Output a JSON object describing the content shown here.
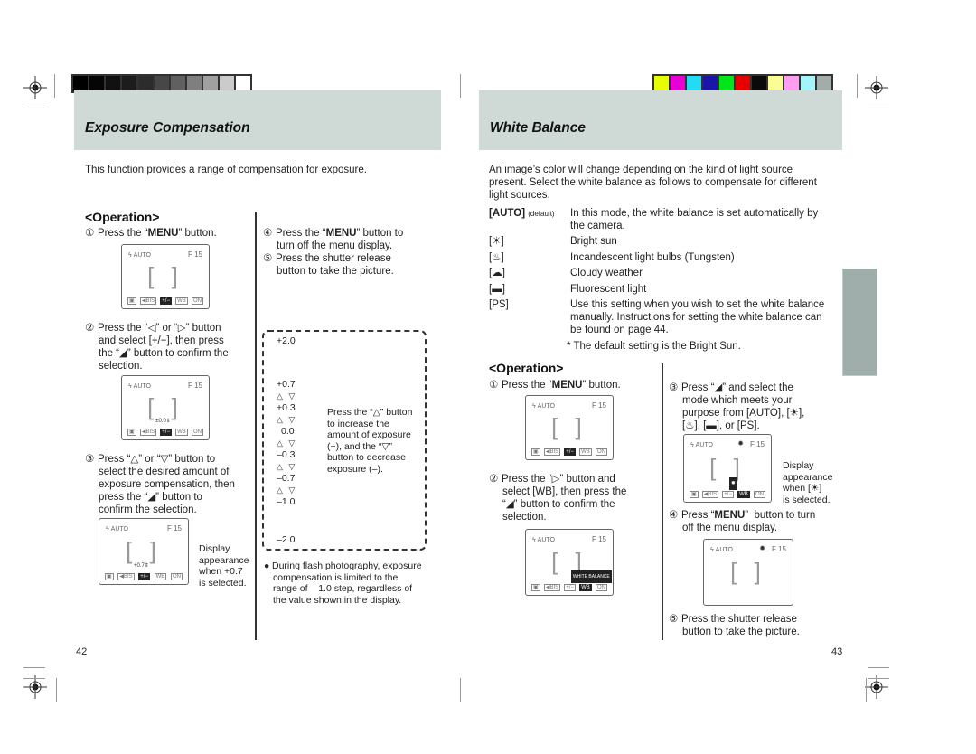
{
  "calibration": {
    "grayscale": [
      "#000000",
      "#050505",
      "#111111",
      "#1c1c1c",
      "#2c2c2c",
      "#474747",
      "#606060",
      "#7f7f7f",
      "#a0a0a0",
      "#cbcbcb",
      "#ffffff"
    ],
    "colors": [
      "#e6ff00",
      "#e600d6",
      "#22dcf5",
      "#1a16a8",
      "#00e61a",
      "#e80000",
      "#0a0a0a",
      "#fcfc94",
      "#ff9eee",
      "#a3f5fa",
      "#a2acab"
    ]
  },
  "left_page": {
    "title": "Exposure Compensation",
    "intro": "This function provides a range of compensation for exposure.",
    "operation_heading": "<Operation>",
    "steps": [
      {
        "num": "①",
        "text_pre": "Press the “",
        "bold": "MENU",
        "text_post": "” button."
      },
      {
        "num": "②",
        "lines": [
          "Press the “◁” or “▷” button",
          "and select [+/−], then press",
          "the “◢” button to confirm the",
          "selection."
        ]
      },
      {
        "num": "③",
        "lines": [
          "Press “△” or “▽” button to",
          "select the desired amount of",
          "exposure compensation, then",
          "press the “◢” button to",
          "confirm the selection."
        ]
      },
      {
        "num": "④",
        "text_pre": "Press the “",
        "bold": "MENU",
        "text_post": "” button to",
        "line2": "turn off the menu display."
      },
      {
        "num": "⑤",
        "lines": [
          "Press the shutter release",
          "button to take the picture."
        ]
      }
    ],
    "display_caption": [
      "Display",
      "appearance",
      "when +0.7",
      "is selected."
    ],
    "lcd": {
      "flash": "ϟ AUTO",
      "fnum": "F  15",
      "icons": [
        "▣",
        "◀BIS",
        "+/−",
        "WB",
        "ON"
      ],
      "value_step2": "±0.0⇕",
      "value_step3": "+0.7⇕"
    },
    "scale": {
      "values": [
        "+2.0",
        "+0.7",
        "+0.3",
        "0.0",
        "–0.3",
        "–0.7",
        "–1.0",
        "–2.0"
      ],
      "arrows": "△ ▽",
      "note": [
        "Press the “△” button",
        "to increase the",
        "amount of exposure",
        "(+), and the “▽”",
        "button to decrease",
        "exposure (–)."
      ]
    },
    "flash_note": [
      "During flash photography, exposure",
      "compensation is limited to the",
      "range of    1.0 step, regardless of",
      "the value shown in the display."
    ],
    "page_number": "42"
  },
  "right_page": {
    "title": "White Balance",
    "intro": [
      "An image’s color will change depending on the kind of light source",
      "present. Select the white balance as follows to compensate for different",
      "light sources."
    ],
    "modes": [
      {
        "key": "[AUTO]",
        "key_note": "(default)",
        "icon": "auto",
        "desc": [
          "In this mode, the white balance is set automatically by",
          "the camera."
        ]
      },
      {
        "key": "[☀]",
        "icon": "bright-sun",
        "desc": [
          "Bright sun"
        ]
      },
      {
        "key": "[♨]",
        "icon": "incandescent",
        "desc": [
          "Incandescent light bulbs (Tungsten)"
        ]
      },
      {
        "key": "[☁]",
        "icon": "cloudy",
        "desc": [
          "Cloudy weather"
        ]
      },
      {
        "key": "[▬]",
        "icon": "fluorescent",
        "desc": [
          "Fluorescent light"
        ]
      },
      {
        "key": "[PS]",
        "icon": "preset",
        "desc": [
          "Use this setting when you wish to set the white balance",
          "manually. Instructions for setting the white balance can",
          "be found on page 44."
        ]
      }
    ],
    "default_note": "* The default setting is the Bright Sun.",
    "operation_heading": "<Operation>",
    "steps": [
      {
        "num": "①",
        "text_pre": "Press the “",
        "bold": "MENU",
        "text_post": "” button."
      },
      {
        "num": "②",
        "lines": [
          "Press the “▷” button and",
          "select [WB], then press the",
          "“◢” button to confirm the",
          "selection."
        ]
      },
      {
        "num": "③",
        "lines": [
          "Press “◢” and select the",
          "mode which meets your",
          "purpose from [AUTO], [☀],",
          "[♨], [▬], or [PS]."
        ]
      },
      {
        "num": "④",
        "text_pre": "Press “",
        "bold": "MENU",
        "text_post": "”  button to turn",
        "line2": "off the menu display."
      },
      {
        "num": "⑤",
        "lines": [
          "Press the shutter release",
          "button to take the picture."
        ]
      }
    ],
    "display_caption": [
      "Display",
      "appearance",
      "when [☀]",
      "is selected."
    ],
    "wb_tag": "WHITE BALANCE",
    "page_number": "43"
  }
}
